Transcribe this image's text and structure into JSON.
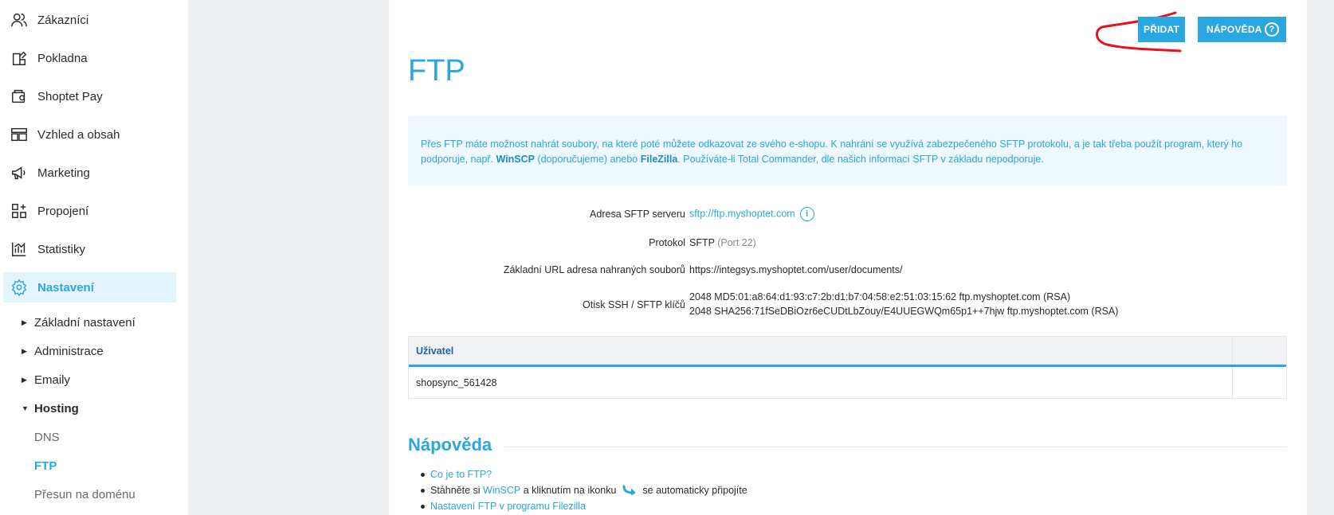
{
  "sidebar": {
    "items": [
      {
        "label": "Zákazníci",
        "icon": "users-icon"
      },
      {
        "label": "Pokladna",
        "icon": "cash-register-icon"
      },
      {
        "label": "Shoptet Pay",
        "icon": "wallet-icon"
      },
      {
        "label": "Vzhled a obsah",
        "icon": "layout-icon"
      },
      {
        "label": "Marketing",
        "icon": "megaphone-icon"
      },
      {
        "label": "Propojení",
        "icon": "apps-plus-icon"
      },
      {
        "label": "Statistiky",
        "icon": "chart-icon"
      },
      {
        "label": "Nastavení",
        "icon": "gear-icon",
        "active": true
      }
    ],
    "subitems": [
      {
        "label": "Základní nastavení"
      },
      {
        "label": "Administrace"
      },
      {
        "label": "Emaily"
      },
      {
        "label": "Hosting",
        "expanded": true
      }
    ],
    "hosting_children": [
      {
        "label": "DNS"
      },
      {
        "label": "FTP",
        "active": true
      },
      {
        "label": "Přesun na doménu"
      }
    ]
  },
  "header": {
    "add_label": "PŘIDAT",
    "help_label": "NÁPOVĚDA",
    "help_icon": "?"
  },
  "page": {
    "title": "FTP",
    "info": {
      "part1": "Přes FTP máte možnost nahrát soubory, na které poté můžete odkazovat ze svého e-shopu. K nahrání se využívá zabezpečeného SFTP protokolu, a je tak třeba použít program, který ho podporuje, např. ",
      "winscp": "WinSCP",
      "part2": " (doporučujeme) anebo ",
      "filezilla": "FileZilla",
      "part3": ". Používáte-li Total Commander, dle našich informací SFTP v základu nepodporuje."
    },
    "details": {
      "server_label": "Adresa SFTP serveru",
      "server_value": "sftp://ftp.myshoptet.com",
      "info_icon": "i",
      "protocol_label": "Protokol",
      "protocol_value": "SFTP",
      "protocol_port": "(Port 22)",
      "url_label": "Základní URL adresa nahraných souborů",
      "url_value": "https://integsys.myshoptet.com/user/documents/",
      "fingerprint_label": "Otisk SSH / SFTP klíčů",
      "fingerprint_md5": "2048 MD5:01:a8:64:d1:93:c7:2b:d1:b7:04:58:e2:51:03:15:62 ftp.myshoptet.com (RSA)",
      "fingerprint_sha": "2048 SHA256:71fSeDBiOzr6eCUDtLbZouy/E4UUEGWQm65p1++7hjw ftp.myshoptet.com (RSA)"
    },
    "table": {
      "header_user": "Uživatel",
      "rows": [
        {
          "user": "shopsync_561428"
        }
      ]
    },
    "help": {
      "title": "Nápověda",
      "item1": "Co je to FTP?",
      "item2_pre": "Stáhněte si ",
      "item2_link": "WinSCP",
      "item2_mid": " a kliknutím na ikonku ",
      "item2_post": " se automaticky připojíte",
      "item3": "Nastavení FTP v programu Filezilla"
    }
  },
  "colors": {
    "accent": "#2aa6e0",
    "annotation": "#e3141f"
  }
}
